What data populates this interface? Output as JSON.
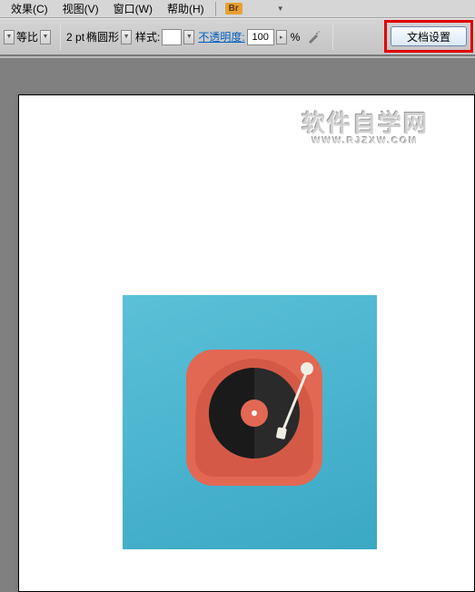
{
  "menubar": {
    "items": [
      "效果(C)",
      "视图(V)",
      "窗口(W)",
      "帮助(H)"
    ],
    "bridge_label": "Br"
  },
  "toolbar": {
    "ratio_label": "等比",
    "stroke_value": "2 pt",
    "shape_label": "椭圆形",
    "style_label": "样式:",
    "opacity_label": "不透明度:",
    "opacity_value": "100",
    "percent": "%"
  },
  "doc_settings": {
    "label": "文档设置"
  },
  "watermark": {
    "main": "软件自学网",
    "sub": "WWW.RJZXW.COM"
  }
}
